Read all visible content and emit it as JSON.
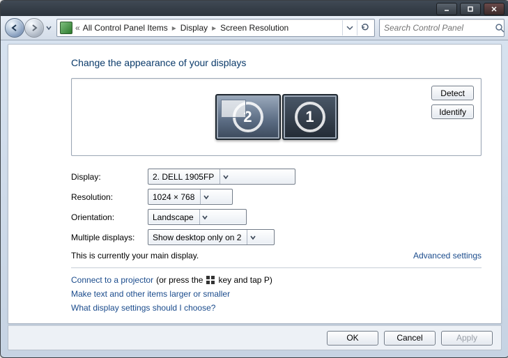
{
  "titlebar": {},
  "breadcrumbs": {
    "root": "«",
    "p1": "All Control Panel Items",
    "p2": "Display",
    "p3": "Screen Resolution"
  },
  "search": {
    "placeholder": "Search Control Panel"
  },
  "page": {
    "heading": "Change the appearance of your displays",
    "detect": "Detect",
    "identify": "Identify",
    "monitor2": "2",
    "monitor1": "1"
  },
  "form": {
    "display_label": "Display:",
    "display_value": "2. DELL 1905FP",
    "resolution_label": "Resolution:",
    "resolution_value": "1024 × 768",
    "orientation_label": "Orientation:",
    "orientation_value": "Landscape",
    "multiple_label": "Multiple displays:",
    "multiple_value": "Show desktop only on 2"
  },
  "notes": {
    "main_display": "This is currently your main display.",
    "advanced": "Advanced settings",
    "projector_a": "Connect to a projector",
    "projector_b": "(or press the",
    "projector_c": "key and tap P)",
    "textsize": "Make text and other items larger or smaller",
    "which": "What display settings should I choose?"
  },
  "buttons": {
    "ok": "OK",
    "cancel": "Cancel",
    "apply": "Apply"
  }
}
